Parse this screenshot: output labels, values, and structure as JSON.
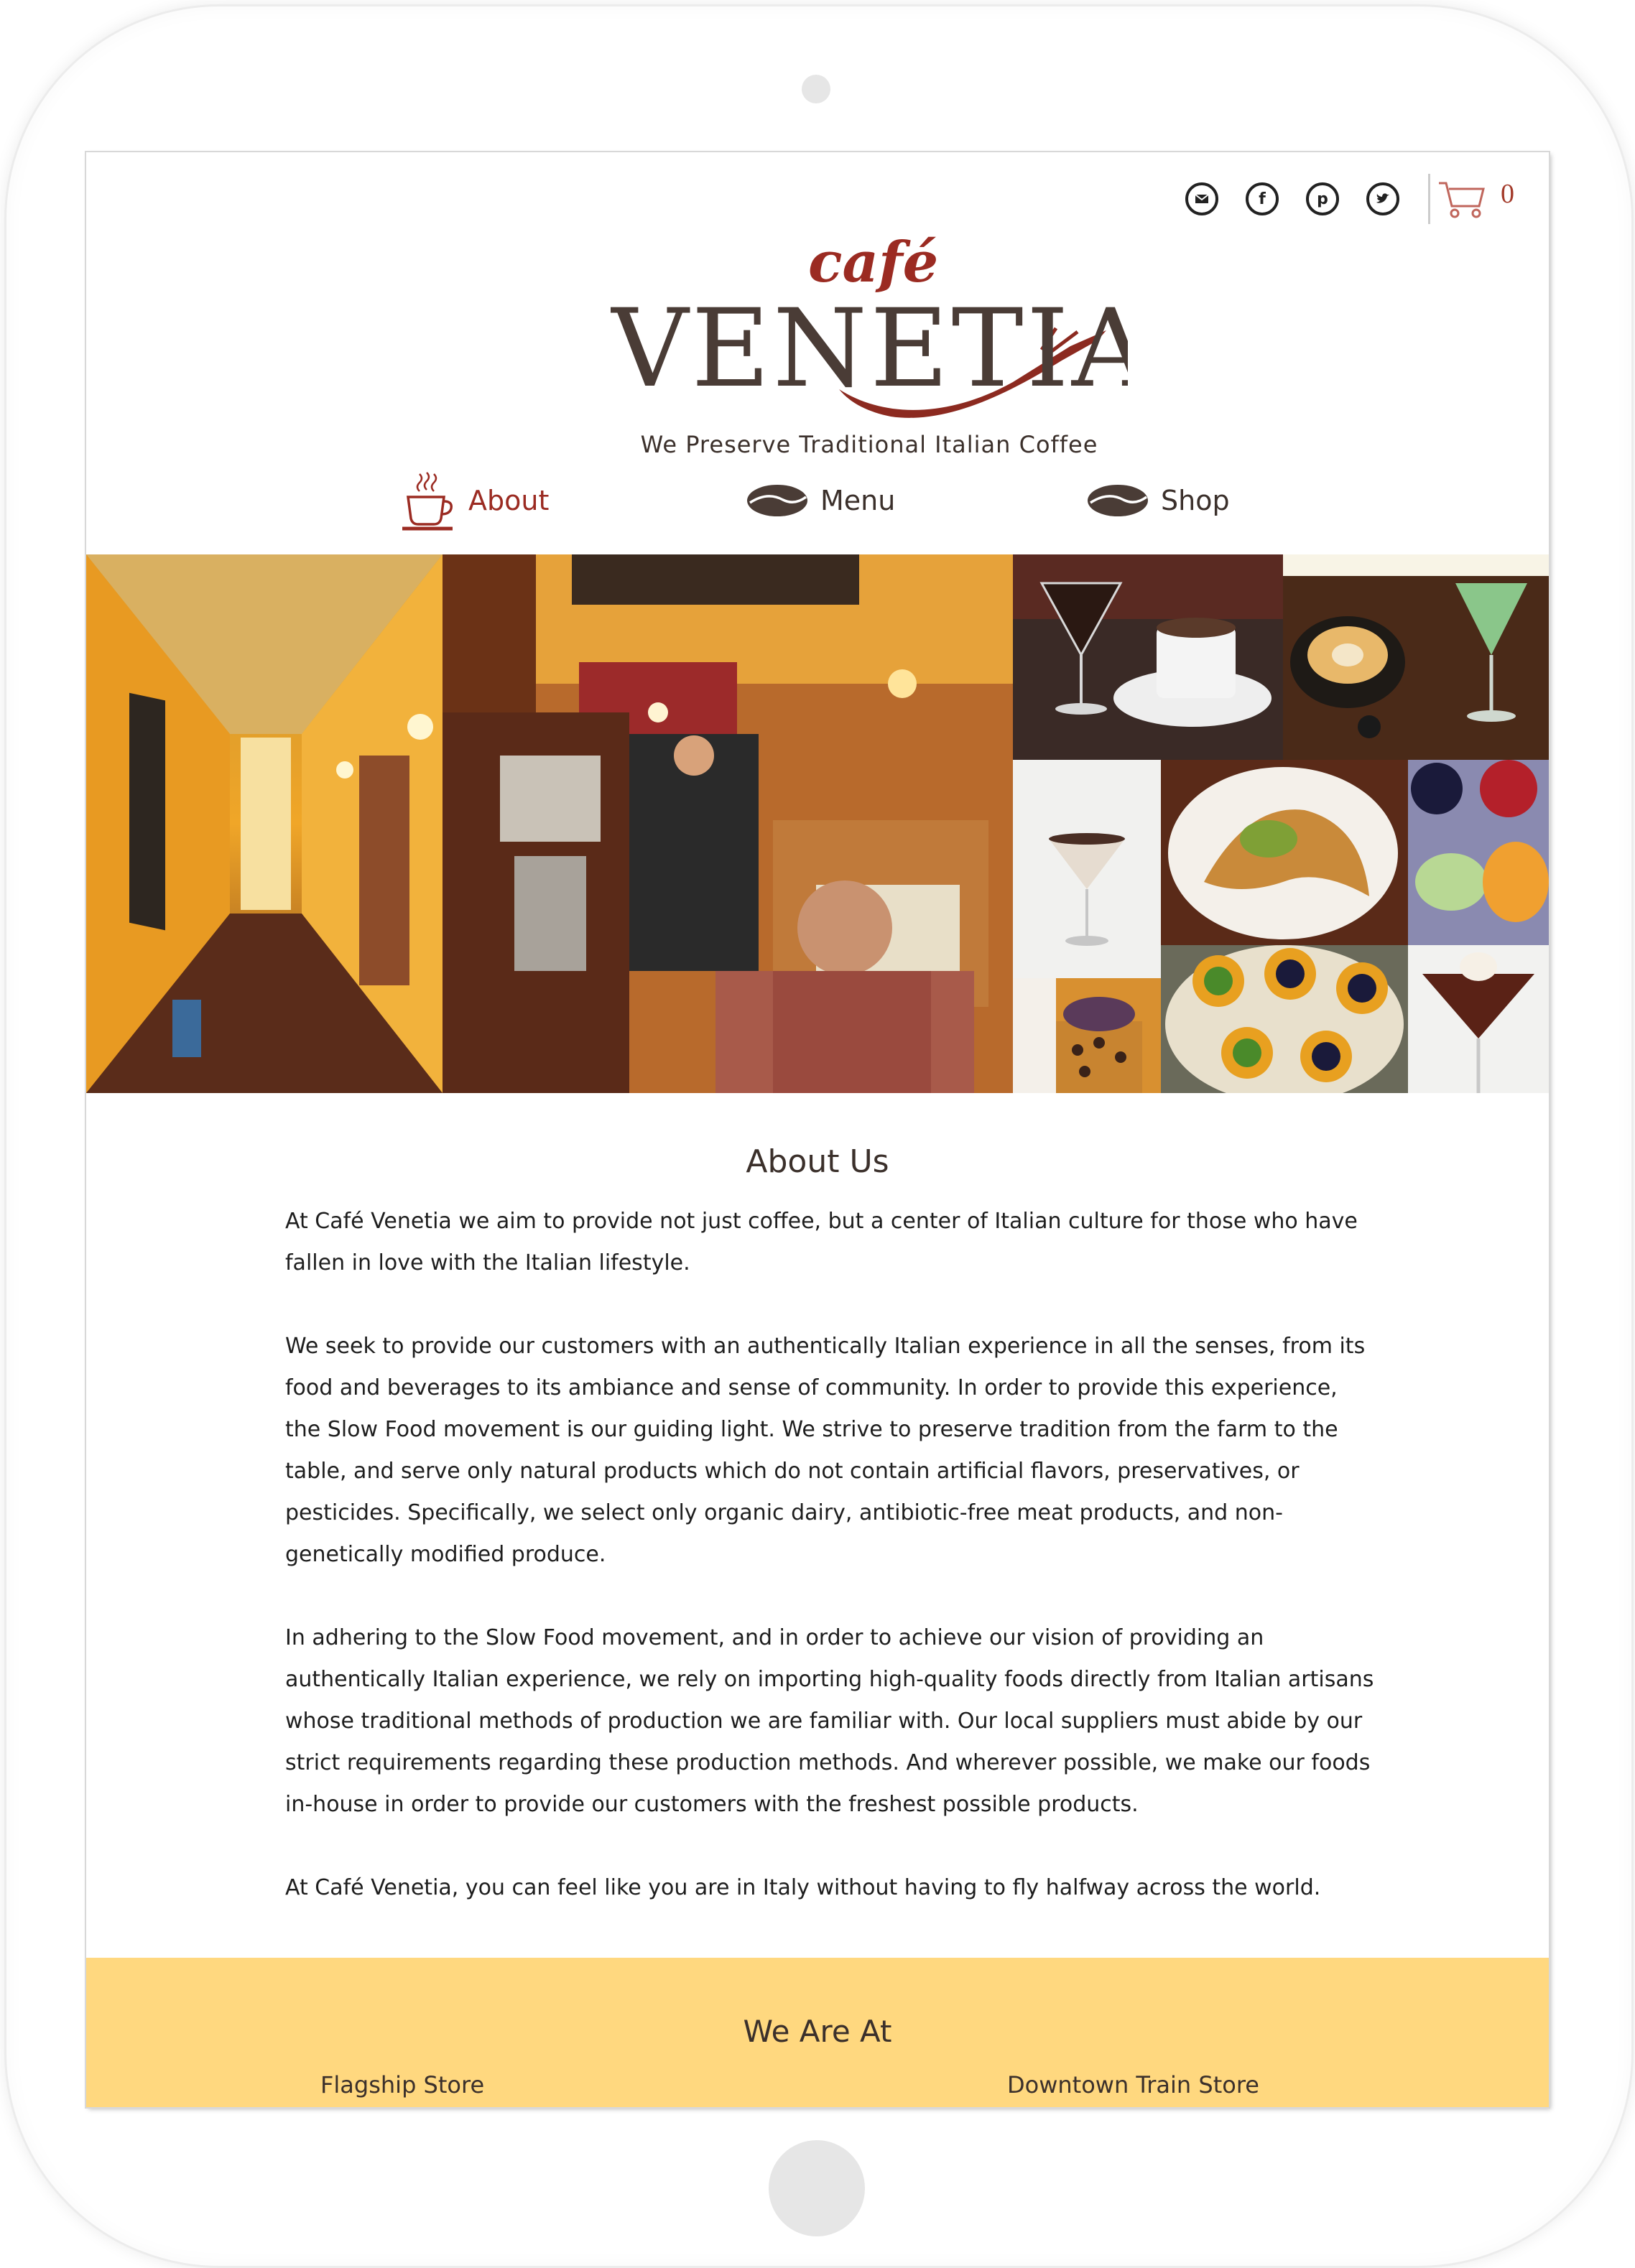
{
  "header": {
    "social": [
      {
        "name": "email",
        "icon": "email-icon"
      },
      {
        "name": "facebook",
        "icon": "facebook-icon",
        "glyph": "f"
      },
      {
        "name": "pinterest",
        "icon": "pinterest-icon",
        "glyph": "p"
      },
      {
        "name": "twitter",
        "icon": "twitter-icon"
      }
    ],
    "cart": {
      "icon": "cart-icon",
      "count": "0"
    }
  },
  "logo": {
    "cafe": "café",
    "name": "VENETIA",
    "tagline": "We Preserve Traditional Italian Coffee"
  },
  "nav": {
    "items": [
      {
        "label": "About",
        "icon": "coffee-cup-icon",
        "active": true
      },
      {
        "label": "Menu",
        "icon": "coffee-bean-icon",
        "active": false
      },
      {
        "label": "Shop",
        "icon": "coffee-bean-icon",
        "active": false
      }
    ]
  },
  "about": {
    "title": "About Us",
    "paragraphs": [
      "At Café Venetia we aim to provide not just coffee, but a center of Italian culture for those who have fallen in love with the Italian lifestyle.",
      "We seek to provide our customers with an authentically Italian experience in all the senses, from its food and beverages to its ambiance and sense of community. In order to provide this experience, the Slow Food movement is our guiding light. We strive to preserve tradition from the farm to the table, and serve only natural products which do not contain artificial flavors, preservatives, or pesticides. Specifically, we select only organic dairy, antibiotic-free meat products, and non-genetically modified produce.",
      "In adhering to the Slow Food movement, and in order to achieve our vision of providing an authentically Italian experience, we rely on importing high-quality foods directly from Italian artisans whose traditional methods of production we are familiar with. Our local suppliers must abide by our strict requirements regarding these production methods. And wherever possible, we make our foods in-house in order to provide our customers with the freshest possible products.",
      "At Café Venetia, you can feel like you are in Italy without having to fly halfway across the world."
    ]
  },
  "locations": {
    "title": "We Are At",
    "stores": [
      "Flagship Store",
      "Downtown Train Store"
    ]
  },
  "colors": {
    "accent": "#9b2b22",
    "text": "#3b302b",
    "footer_bg": "#ffd87f"
  }
}
